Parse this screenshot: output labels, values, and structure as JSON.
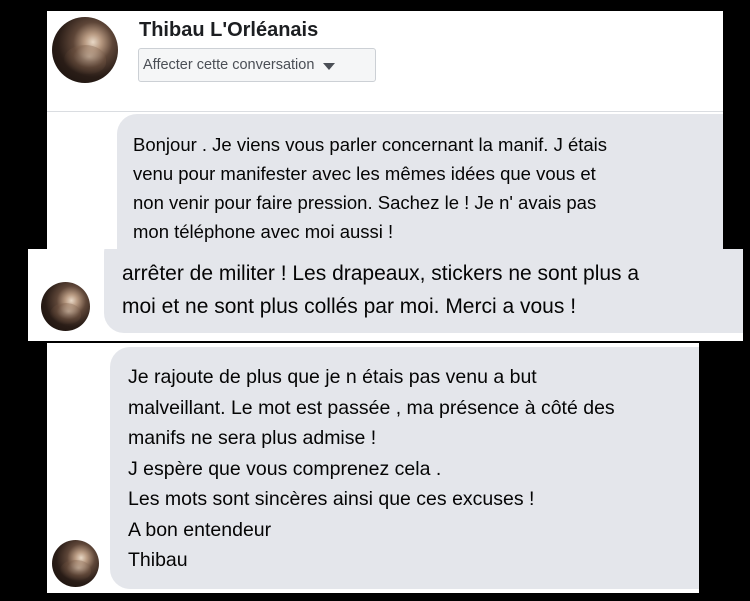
{
  "header": {
    "contact_name": "Thibau L'Orléanais",
    "assign_label": "Affecter cette conversation",
    "avatar_icon": "profile-photo"
  },
  "messages": {
    "first": [
      "Bonjour . Je viens vous parler concernant la manif. J étais",
      "venu pour manifester avec les mêmes idées que vous et",
      "non venir pour faire pression.  Sachez le ! Je n' avais pas",
      "mon téléphone avec moi aussi !"
    ],
    "second": [
      "arrêter de militer ! Les drapeaux, stickers ne sont plus a",
      "moi et ne sont plus collés par moi. Merci a vous !"
    ],
    "third": [
      "Je rajoute de plus que je n étais pas venu a but",
      "malveillant. Le mot est passée , ma présence à côté des",
      "manifs ne sera plus admise !",
      "J espère que vous comprenez cela .",
      "Les mots sont sincères ainsi que ces excuses !",
      "A bon entendeur",
      "Thibau"
    ]
  },
  "colors": {
    "bubble_bg": "#e4e6eb",
    "page_bg": "#000000",
    "panel_bg": "#ffffff"
  }
}
